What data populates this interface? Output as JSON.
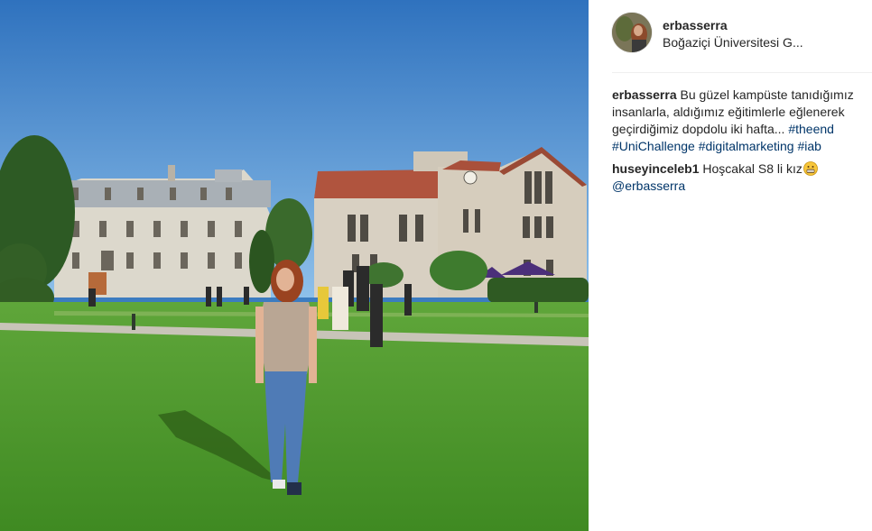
{
  "post": {
    "author": "erbasserra",
    "location": "Boğaziçi Üniversitesi G..."
  },
  "caption": {
    "user": "erbasserra",
    "text_line1": "Bu güzel kampüste tanıdığımız insanlarla, aldığımız eğitimlerle eğlenerek geçirdiğimiz dopdolu iki hafta...",
    "hashtags": [
      "#theend",
      "#UniChallenge",
      "#digitalmarketing",
      "#iab"
    ]
  },
  "comments": [
    {
      "user": "huseyinceleb1",
      "text": "Hoşcakal S8 li kız",
      "emoji": "grinning-face-emoji",
      "mention": "@erbasserra"
    }
  ],
  "colors": {
    "link": "#003569",
    "text": "#262626",
    "divider": "#efefef",
    "sky": "#3c7cc0",
    "grass": "#4d9a2b"
  }
}
